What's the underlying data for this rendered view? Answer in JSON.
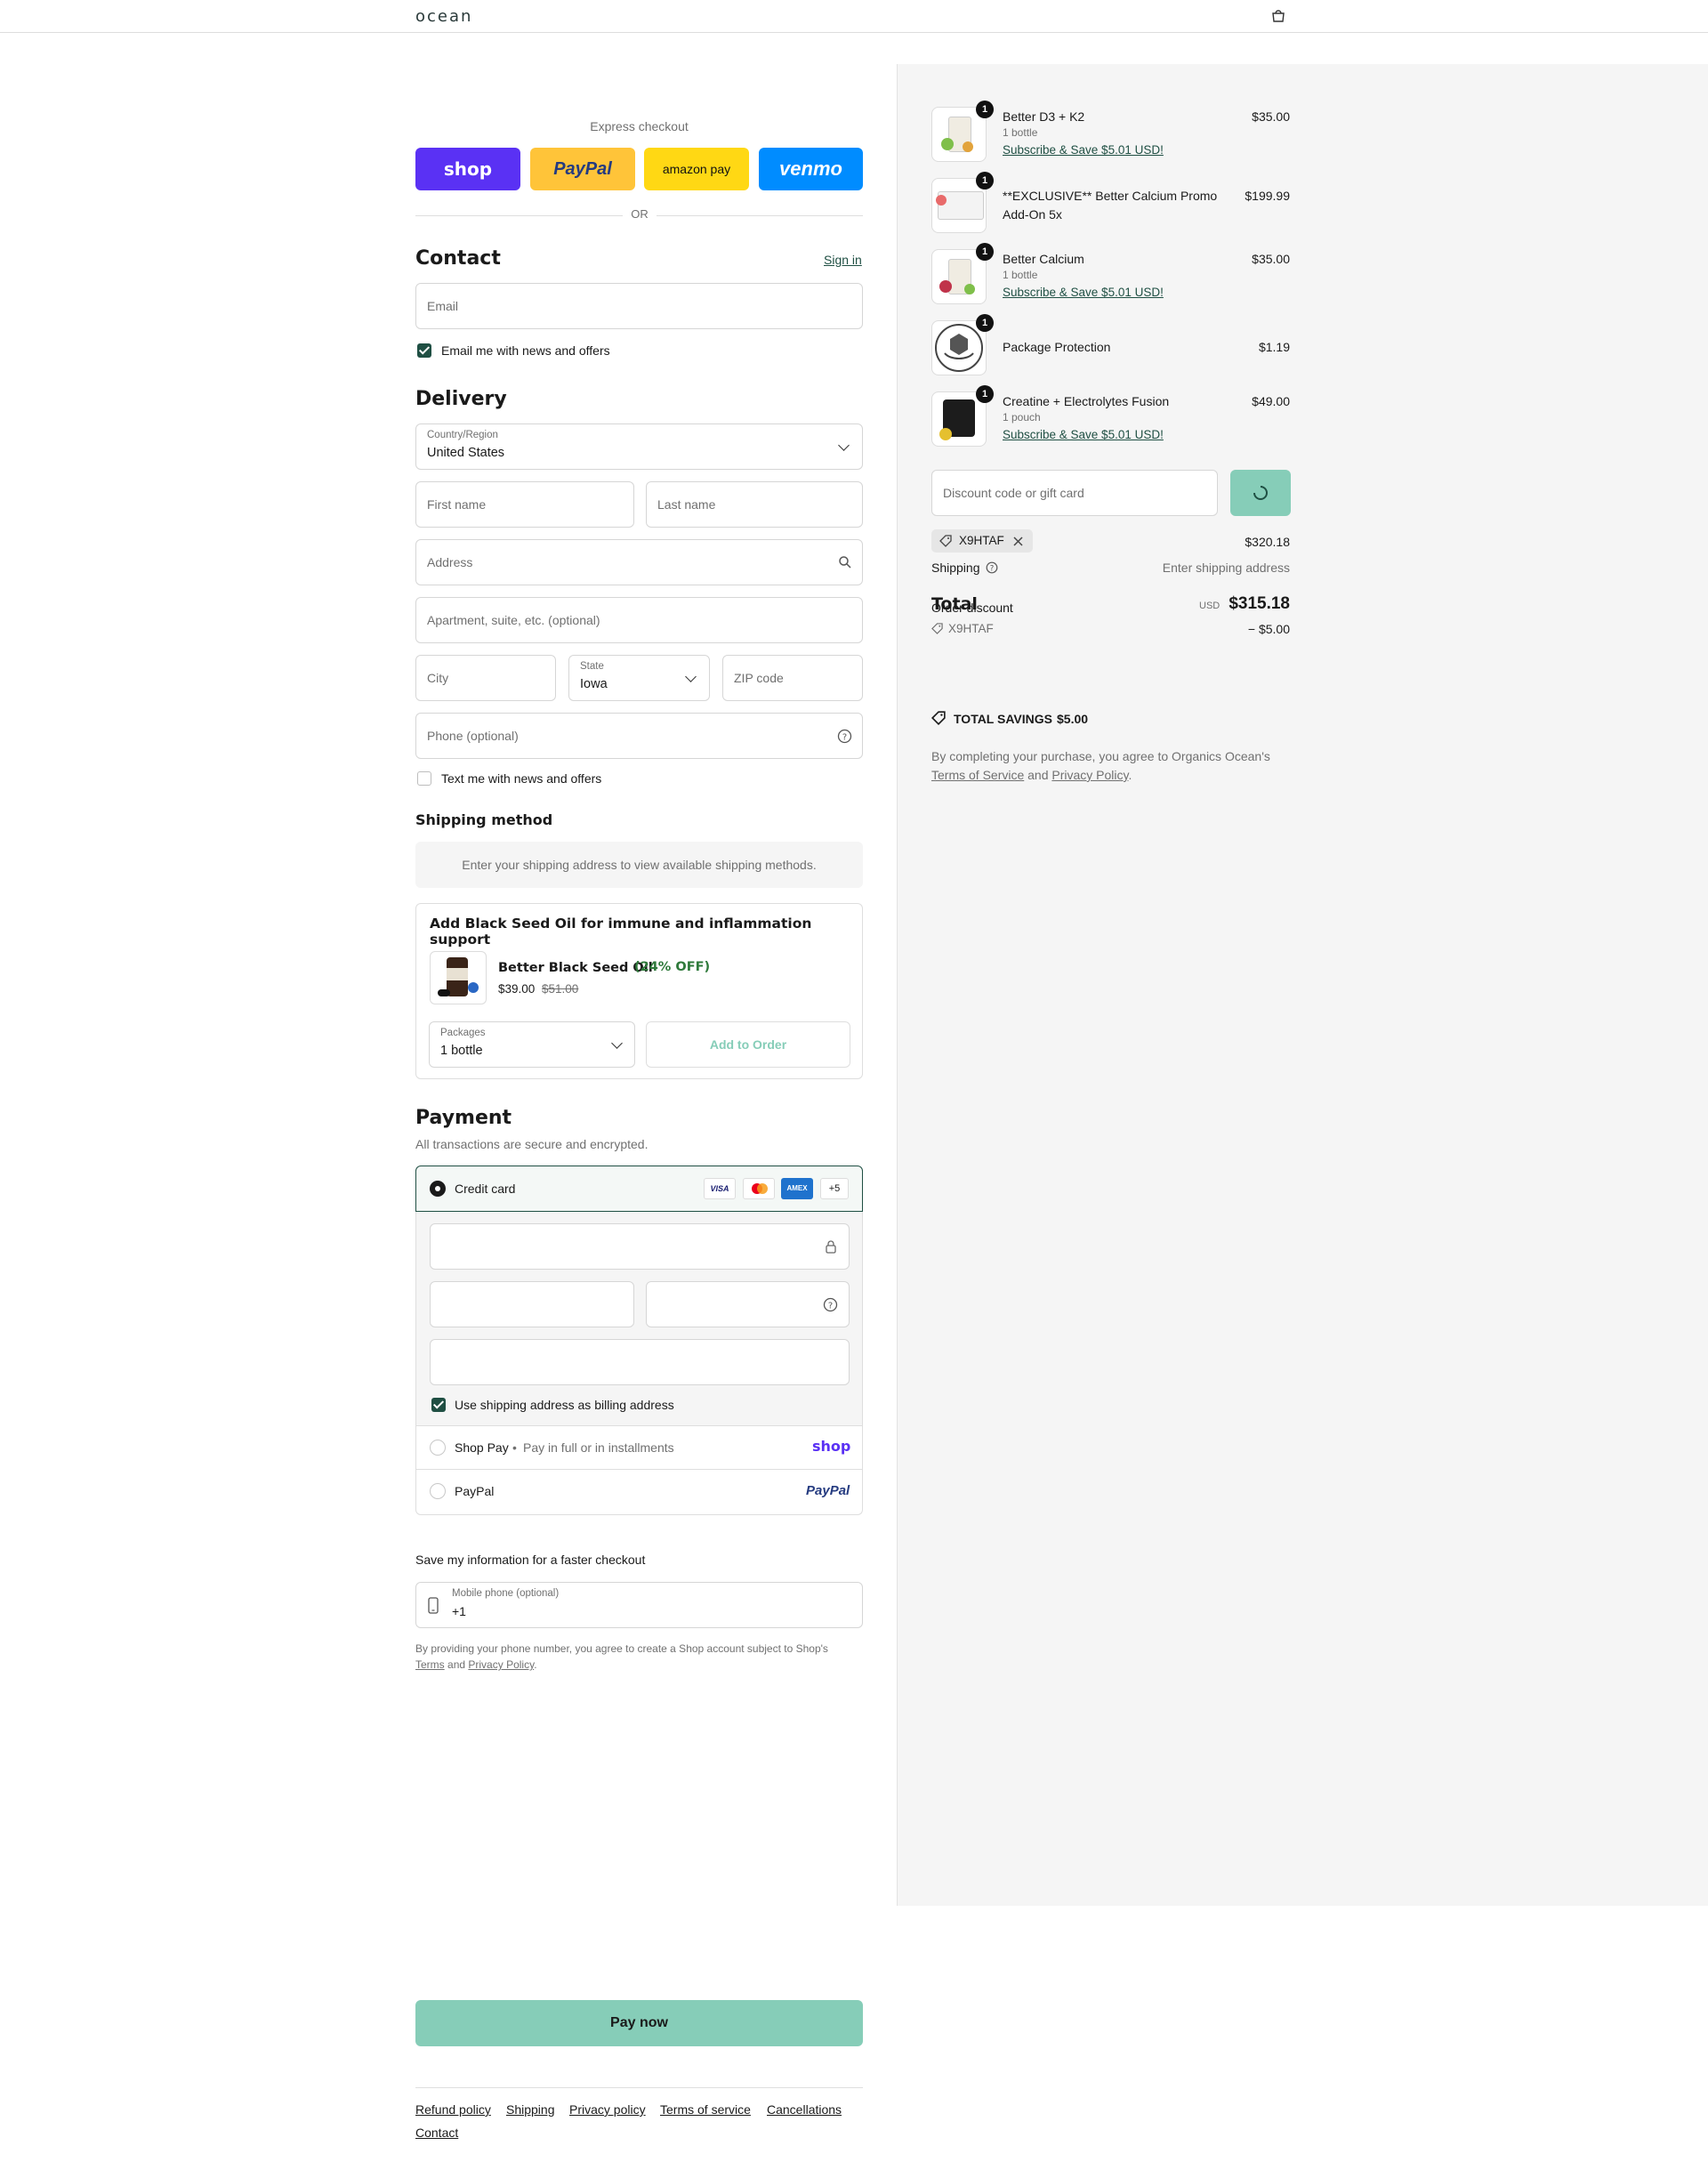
{
  "brand": {
    "logo_text": "ocean",
    "accent": "#1f4f43",
    "pay_button_color": "#86cdb8"
  },
  "express": {
    "label": "Express checkout",
    "buttons": [
      {
        "label": "shop",
        "color": "#5a31f4"
      },
      {
        "label": "PayPal",
        "color": "#ffc439"
      },
      {
        "label": "amazon pay",
        "color": "#ffd814"
      },
      {
        "label": "venmo",
        "color": "#008cff"
      }
    ],
    "or": "OR"
  },
  "contact": {
    "title": "Contact",
    "sign_in": "Sign in",
    "email_placeholder": "Email",
    "news_label": "Email me with news and offers",
    "news_checked": true
  },
  "delivery": {
    "title": "Delivery",
    "country_label": "Country/Region",
    "country_value": "United States",
    "first_name": "First name",
    "last_name": "Last name",
    "address": "Address",
    "apartment": "Apartment, suite, etc. (optional)",
    "city": "City",
    "state_label": "State",
    "state_value": "Iowa",
    "zip": "ZIP code",
    "phone": "Phone (optional)",
    "text_label": "Text me with news and offers",
    "text_checked": false
  },
  "shipping_method": {
    "title": "Shipping method",
    "message": "Enter your shipping address to view available shipping methods."
  },
  "upsell": {
    "title": "Add Black Seed Oil for immune and inflammation support",
    "product": "Better Black Seed Oil",
    "discount": "(24% OFF)",
    "price": "$39.00",
    "compare_price": "$51.00",
    "packages_label": "Packages",
    "packages_value": "1 bottle",
    "add_button": "Add to Order"
  },
  "payment": {
    "title": "Payment",
    "subtitle": "All transactions are secure and encrypted.",
    "credit_card": "Credit card",
    "card_brands": [
      "VISA",
      "mastercard",
      "AMEX"
    ],
    "more_brands": "+5",
    "billing_label": "Use shipping address as billing address",
    "billing_checked": true,
    "shop_pay": "Shop Pay",
    "shop_pay_sub": "Pay in full or in installments",
    "shop_pay_logo": "shop",
    "paypal": "PayPal",
    "paypal_logo": "PayPal"
  },
  "save_info": {
    "title": "Save my information for a faster checkout",
    "mobile_label": "Mobile phone (optional)",
    "mobile_value": "+1",
    "disclaimer_1": "By providing your phone number, you agree to create a Shop account subject to Shop's",
    "terms": "Terms",
    "and": "and",
    "privacy": "Privacy Policy",
    "period": "."
  },
  "pay_now": "Pay now",
  "footer_links": [
    "Refund policy",
    "Shipping",
    "Privacy policy",
    "Terms of service",
    "Cancellations",
    "Contact"
  ],
  "order": {
    "items": [
      {
        "qty": "1",
        "name": "Better D3 + K2",
        "sub": "1 bottle",
        "link": "Subscribe & Save $5.01 USD!",
        "price": "$35.00"
      },
      {
        "qty": "1",
        "name": "**EXCLUSIVE** Better Calcium Promo",
        "name2": "Add-On 5x",
        "price": "$199.99"
      },
      {
        "qty": "1",
        "name": "Better Calcium",
        "sub": "1 bottle",
        "link": "Subscribe & Save $5.01 USD!",
        "price": "$35.00"
      },
      {
        "qty": "1",
        "name": "Package Protection",
        "price": "$1.19"
      },
      {
        "qty": "1",
        "name": "Creatine + Electrolytes Fusion",
        "sub": "1 pouch",
        "link": "Subscribe & Save $5.01 USD!",
        "price": "$49.00"
      }
    ],
    "discount_placeholder": "Discount code or gift card",
    "code_tag": "X9HTAF",
    "subtotal_value": "$320.18",
    "shipping_label": "Shipping",
    "shipping_value": "Enter shipping address",
    "order_discount_label": "Order discount",
    "discount_code": "X9HTAF",
    "discount_value": "− $5.00",
    "total_label": "Total",
    "currency": "USD",
    "total_value": "$315.18",
    "savings_label": "TOTAL SAVINGS",
    "savings_value": "$5.00",
    "agree_1": "By completing your purchase, you agree to Organics Ocean's",
    "tos": "Terms of Service",
    "and": "and",
    "privacy": "Privacy Policy",
    "period": "."
  }
}
